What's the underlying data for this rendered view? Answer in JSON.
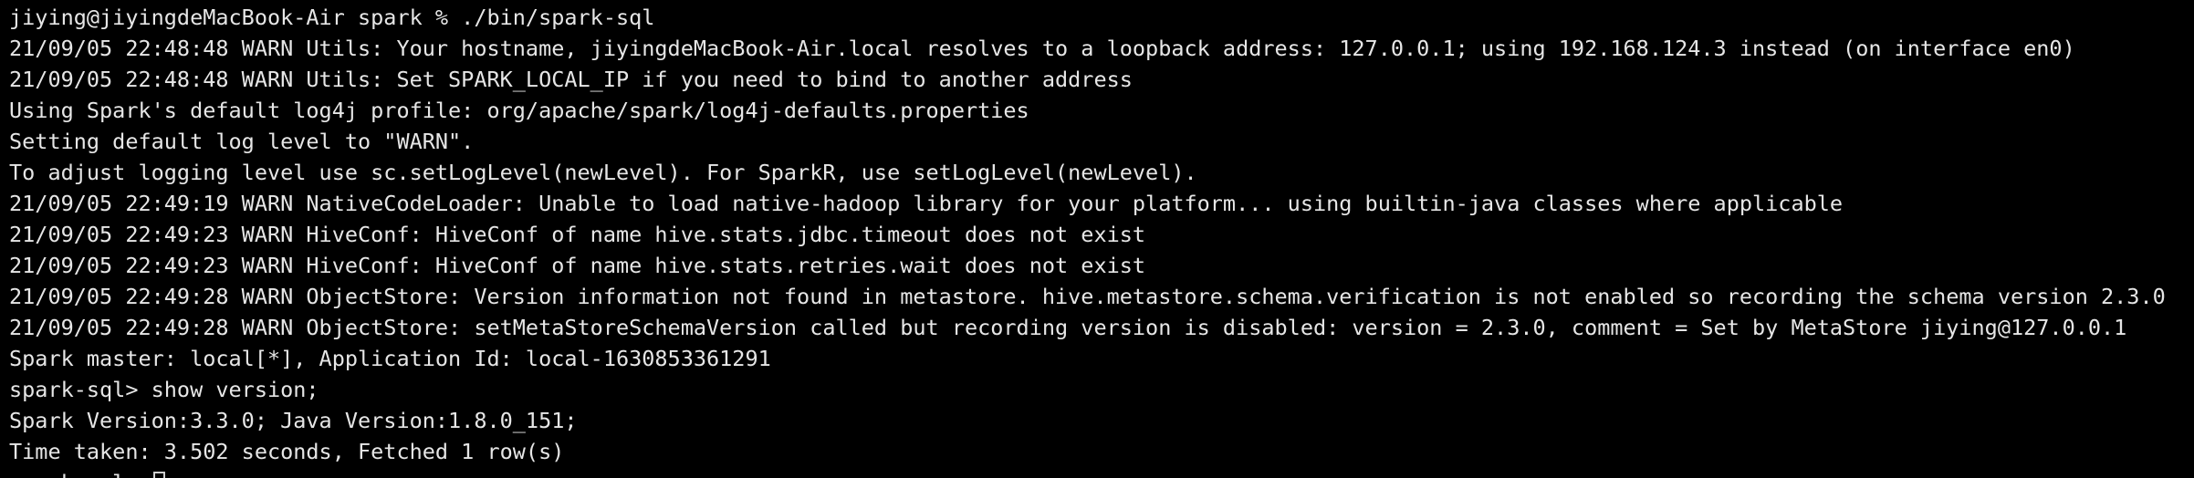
{
  "terminal": {
    "lines": [
      "jiying@jiyingdeMacBook-Air spark % ./bin/spark-sql",
      "21/09/05 22:48:48 WARN Utils: Your hostname, jiyingdeMacBook-Air.local resolves to a loopback address: 127.0.0.1; using 192.168.124.3 instead (on interface en0)",
      "21/09/05 22:48:48 WARN Utils: Set SPARK_LOCAL_IP if you need to bind to another address",
      "Using Spark's default log4j profile: org/apache/spark/log4j-defaults.properties",
      "Setting default log level to \"WARN\".",
      "To adjust logging level use sc.setLogLevel(newLevel). For SparkR, use setLogLevel(newLevel).",
      "21/09/05 22:49:19 WARN NativeCodeLoader: Unable to load native-hadoop library for your platform... using builtin-java classes where applicable",
      "21/09/05 22:49:23 WARN HiveConf: HiveConf of name hive.stats.jdbc.timeout does not exist",
      "21/09/05 22:49:23 WARN HiveConf: HiveConf of name hive.stats.retries.wait does not exist",
      "21/09/05 22:49:28 WARN ObjectStore: Version information not found in metastore. hive.metastore.schema.verification is not enabled so recording the schema version 2.3.0",
      "21/09/05 22:49:28 WARN ObjectStore: setMetaStoreSchemaVersion called but recording version is disabled: version = 2.3.0, comment = Set by MetaStore jiying@127.0.0.1",
      "Spark master: local[*], Application Id: local-1630853361291",
      "spark-sql> show version;",
      "Spark Version:3.3.0; Java Version:1.8.0_151;",
      "Time taken: 3.502 seconds, Fetched 1 row(s)"
    ],
    "current_prompt": "spark-sql> ",
    "colors": {
      "background": "#000000",
      "foreground": "#e6e6e6"
    }
  }
}
